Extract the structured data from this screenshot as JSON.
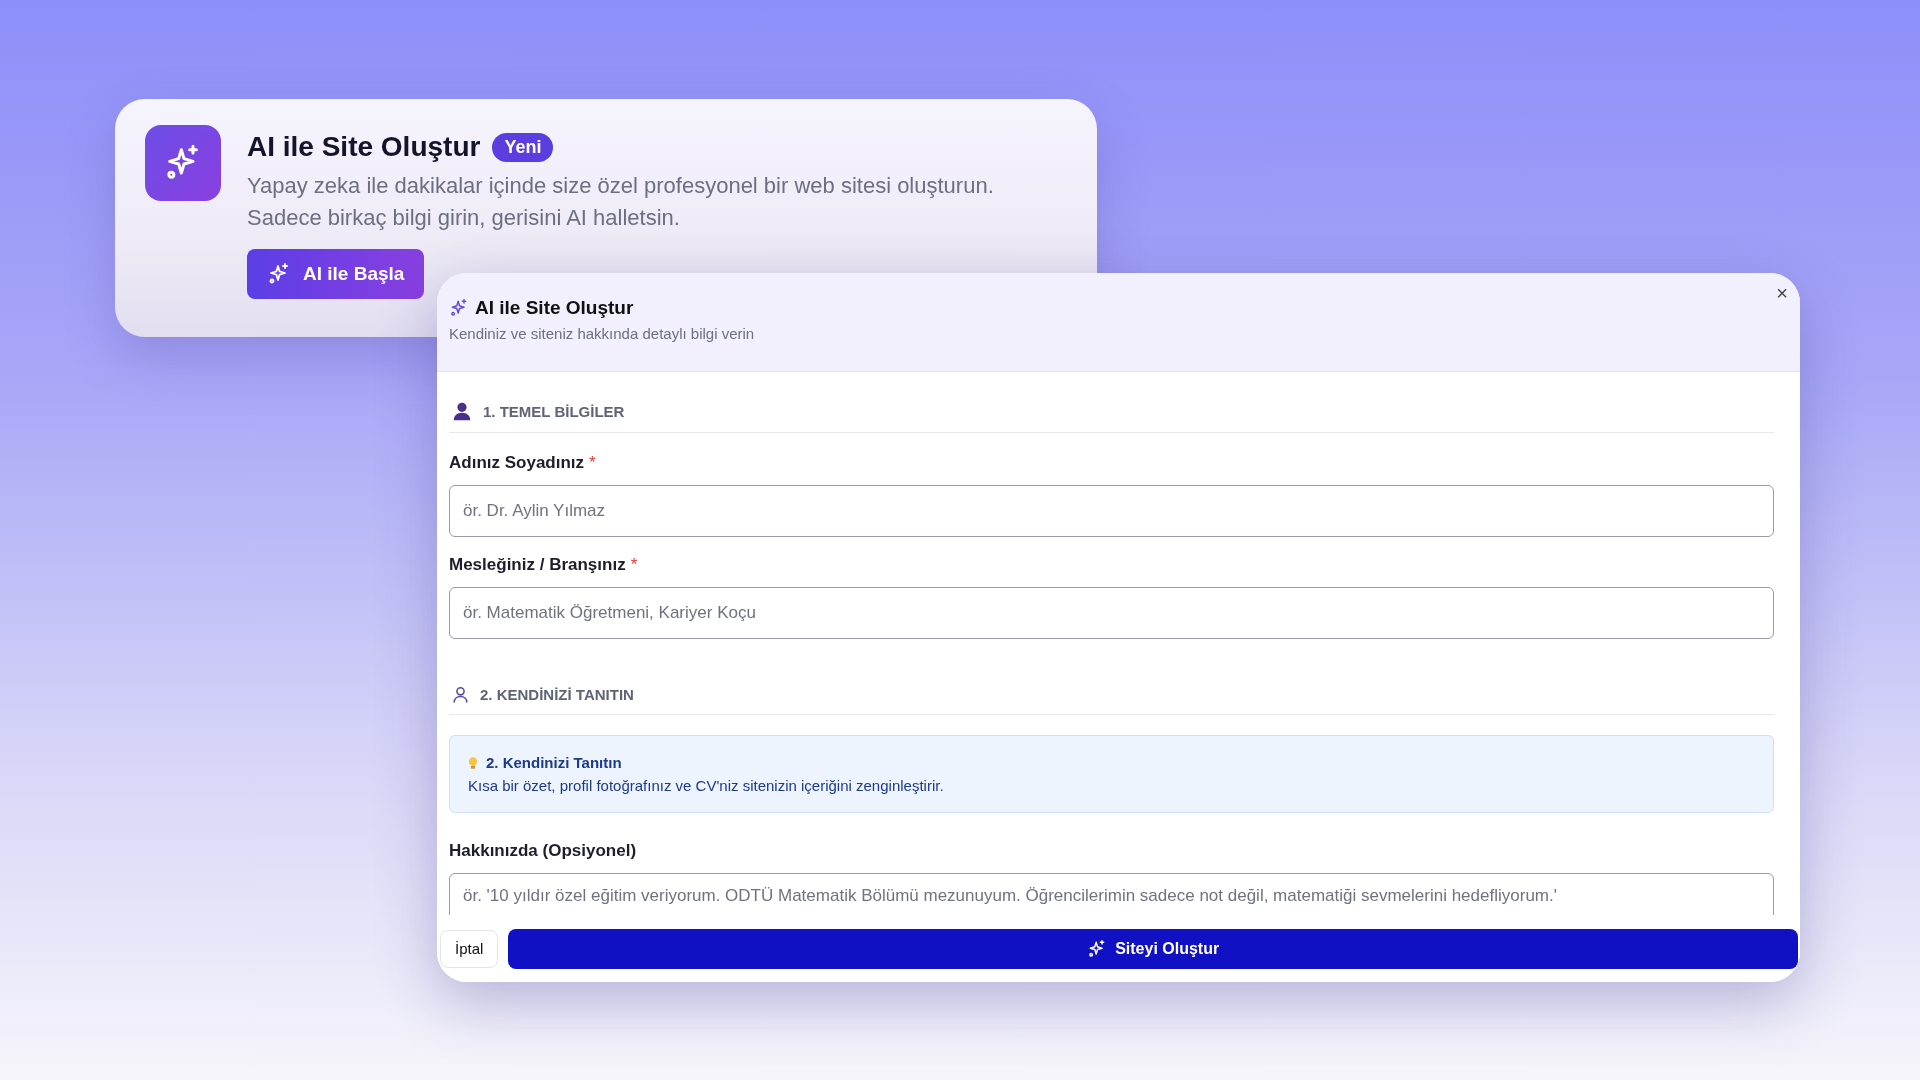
{
  "promo_card": {
    "title": "AI ile Site Oluştur",
    "badge": "Yeni",
    "description_lines": [
      "Yapay zeka ile dakikalar içinde size özel profesyonel bir web sitesi oluşturun.",
      "Sadece birkaç bilgi girin, gerisini AI halletsin."
    ],
    "button": "AI ile Başla"
  },
  "modal": {
    "title": "AI ile Site Oluştur",
    "subtitle": "Kendiniz ve siteniz hakkında detaylı bilgi verin",
    "close": "×",
    "items": [
      {
        "kind": "heading",
        "text": "1. TEMEL BİLGİLER"
      },
      {
        "kind": "field",
        "label": "Adınız Soyadınız",
        "required_mark": "*",
        "placeholder": "ör. Dr. Aylin Yılmaz"
      },
      {
        "kind": "field",
        "label": "Mesleğiniz / Branşınız",
        "required_mark": "*",
        "placeholder": "ör. Matematik Öğretmeni, Kariyer Koçu"
      },
      {
        "kind": "heading",
        "text": "2. KENDİNİZİ TANITIN"
      },
      {
        "kind": "info",
        "title": "2. Kendinizi Tanıtın",
        "text": "Kısa bir özet, profil fotoğrafınız ve CV'niz sitenizin içeriğini zenginleştirir."
      },
      {
        "kind": "textarea",
        "label": "Hakkınızda (Opsiyonel)",
        "placeholder": "ör. '10 yıldır özel eğitim veriyorum. ODTÜ Matematik Bölümü mezunuyum. Öğrencilerimin sadece not değil, matematiği sevmelerini hedefliyorum.'"
      }
    ],
    "cancel": "İptal",
    "submit": "Siteyi Oluştur"
  }
}
